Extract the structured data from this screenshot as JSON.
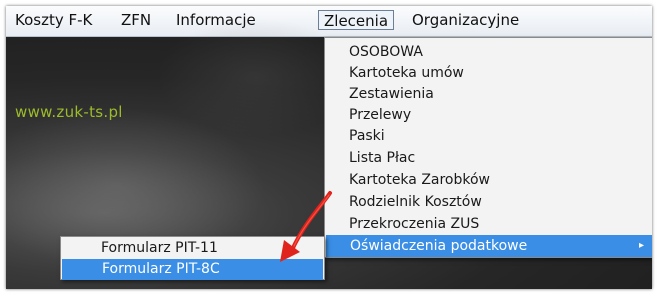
{
  "menubar": {
    "items": [
      {
        "label": "Koszty F-K"
      },
      {
        "label": "ZFN"
      },
      {
        "label": "Informacje"
      },
      {
        "label": "Zlecenia"
      },
      {
        "label": "Organizacyjne"
      }
    ]
  },
  "background": {
    "url_text": "www.zuk-ts.pl"
  },
  "dropdown": {
    "items": [
      {
        "label": "OSOBOWA"
      },
      {
        "label": "Kartoteka umów"
      },
      {
        "label": "Zestawienia"
      },
      {
        "label": "Przelewy"
      },
      {
        "label": "Paski"
      },
      {
        "label": "Lista Płac"
      },
      {
        "label": "Kartoteka Zarobków"
      },
      {
        "label": "Rodzielnik Kosztów"
      },
      {
        "label": "Przekroczenia ZUS"
      },
      {
        "label": "Oświadczenia podatkowe",
        "arrow": "▸"
      }
    ]
  },
  "submenu": {
    "items": [
      {
        "label": "Formularz PIT-11"
      },
      {
        "label": "Formularz PIT-8C"
      }
    ]
  },
  "colors": {
    "highlight": "#3a8ee6",
    "annotation_arrow": "#e0231c",
    "url_text": "#9cbc2a"
  },
  "icons": {
    "submenu_arrow": "submenu-arrow-icon",
    "annotation": "red-arrow-annotation"
  }
}
